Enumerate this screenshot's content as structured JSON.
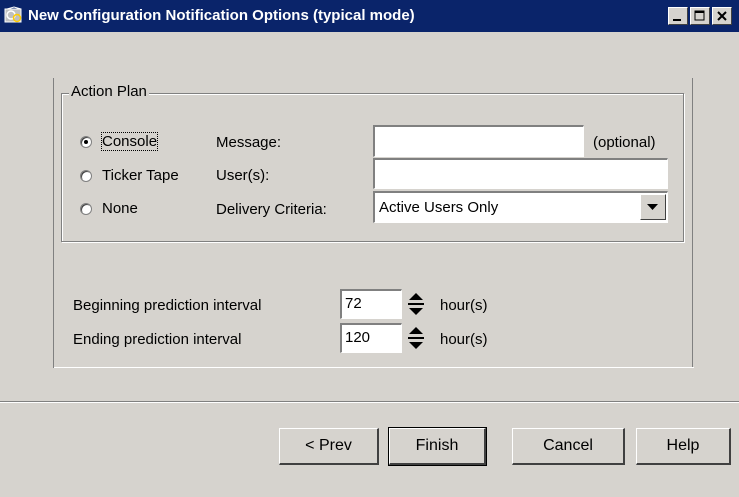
{
  "window": {
    "title": "New Configuration Notification Options (typical mode)"
  },
  "action_plan": {
    "legend": "Action Plan",
    "options": [
      {
        "label": "Console",
        "checked": true,
        "focused": true
      },
      {
        "label": "Ticker Tape",
        "checked": false
      },
      {
        "label": "None",
        "checked": false
      }
    ],
    "message_label": "Message:",
    "message_value": "",
    "optional_note": "(optional)",
    "users_label": "User(s):",
    "users_value": "",
    "delivery_label": "Delivery Criteria:",
    "delivery_value": "Active Users Only"
  },
  "intervals": {
    "beginning_label": "Beginning prediction interval",
    "beginning_value": "72",
    "beginning_unit": "hour(s)",
    "ending_label": "Ending prediction interval",
    "ending_value": "120",
    "ending_unit": "hour(s)"
  },
  "buttons": {
    "prev": "< Prev",
    "finish": "Finish",
    "cancel": "Cancel",
    "help": "Help"
  }
}
